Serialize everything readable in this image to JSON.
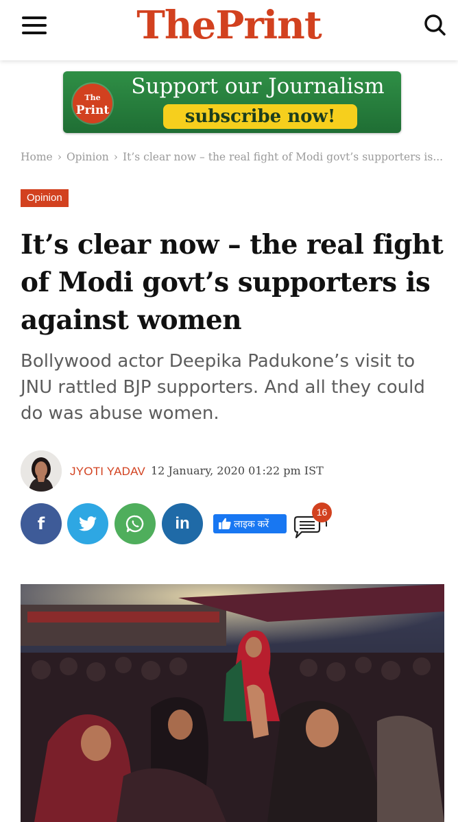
{
  "header": {
    "logo": "ThePrint"
  },
  "banner": {
    "badge_top": "The",
    "badge_bottom": "Print",
    "headline": "Support our Journalism",
    "cta": "subscribe now!"
  },
  "breadcrumb": {
    "items": [
      "Home",
      "Opinion",
      "It’s clear now – the real fight of Modi govt’s supporters is..."
    ],
    "separator": "›"
  },
  "article": {
    "category": "Opinion",
    "title": "It’s clear now – the real fight of Modi govt’s supporters is against women",
    "subtitle": "Bollywood actor Deepika Padukone’s visit to JNU rattled BJP supporters. And all they could do was abuse women.",
    "author": "JYOTI YADAV",
    "date": "12 January, 2020 01:22 pm IST"
  },
  "share": {
    "facebook_label": "f",
    "linkedin_label": "in",
    "like_label": "लाइक करें",
    "comment_count": "16"
  },
  "colors": {
    "brand": "#d2411f",
    "banner_green": "#1f6e34",
    "cta_yellow": "#f6cf1d",
    "facebook": "#3e5b98",
    "twitter": "#2ea7e3",
    "whatsapp": "#4fae5c",
    "linkedin": "#1f6aa7",
    "like_blue": "#1877f2"
  },
  "icons": [
    "menu-icon",
    "search-icon",
    "facebook-icon",
    "twitter-icon",
    "whatsapp-icon",
    "linkedin-icon",
    "thumbs-up-icon",
    "comment-icon"
  ]
}
